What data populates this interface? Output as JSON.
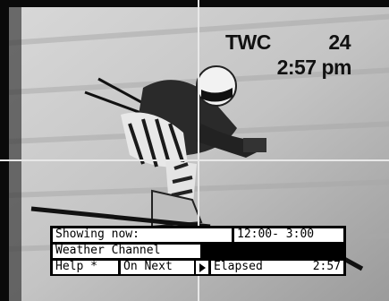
{
  "overlay": {
    "channel_name": "TWC",
    "channel_number": "24",
    "clock": "2:57 pm"
  },
  "info_bar": {
    "showing_label": "Showing now:",
    "time_range": "12:00- 3:00",
    "program_title": "Weather Channel",
    "help_label": "Help *",
    "on_next_label": "On Next",
    "elapsed_label": "Elapsed",
    "elapsed_value": "2:57"
  },
  "icons": {
    "next_arrow": "play-arrow-icon"
  }
}
